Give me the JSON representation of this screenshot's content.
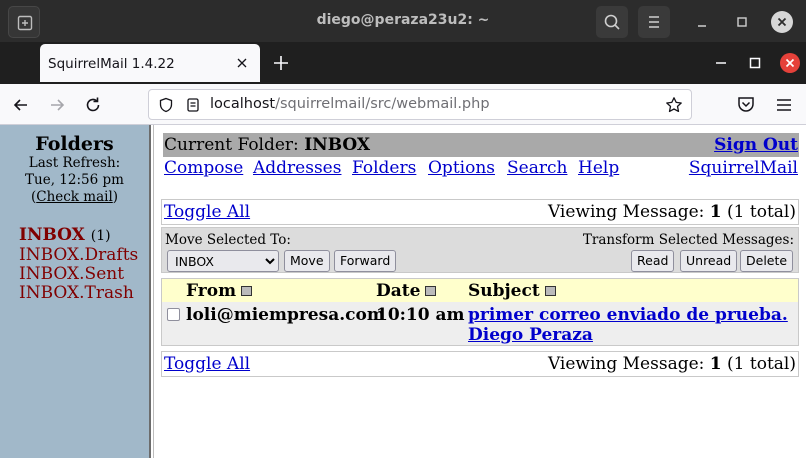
{
  "os": {
    "window_title": "diego@peraza23u2: ~"
  },
  "browser": {
    "tab_title": "SquirrelMail 1.4.22",
    "url_host": "localhost",
    "url_path": "/squirrelmail/src/webmail.php"
  },
  "left_pane": {
    "title": "Folders",
    "last_refresh_label": "Last Refresh:",
    "last_refresh_time": "Tue, 12:56 pm",
    "check_mail_open": "(",
    "check_mail_label": "Check mail",
    "check_mail_close": ")",
    "folders": [
      {
        "name": "INBOX",
        "unread": "(1)"
      },
      {
        "name": "INBOX.Drafts"
      },
      {
        "name": "INBOX.Sent"
      },
      {
        "name": "INBOX.Trash"
      }
    ]
  },
  "header": {
    "current_folder_label": "Current Folder:",
    "current_folder_name": "INBOX",
    "sign_out": "Sign Out",
    "menu": [
      "Compose",
      "Addresses",
      "Folders",
      "Options",
      "Search",
      "Help"
    ],
    "brand_link": "SquirrelMail"
  },
  "list_nav": {
    "toggle_all": "Toggle All",
    "viewing_prefix": "Viewing Message:",
    "viewing_number": "1",
    "viewing_suffix": "(1 total)"
  },
  "actions": {
    "move_selected_label": "Move Selected To:",
    "folder_select_value": "INBOX",
    "move_button": "Move",
    "forward_button": "Forward",
    "transform_label": "Transform Selected Messages:",
    "read_button": "Read",
    "unread_button": "Unread",
    "delete_button": "Delete"
  },
  "message_list": {
    "columns": [
      "From",
      "Date",
      "Subject"
    ],
    "rows": [
      {
        "from": "loli@miempresa.com",
        "date": "10:10 am",
        "subject": "primer correo enviado de prueba. Diego Peraza"
      }
    ]
  },
  "colors": {
    "left_pane_bg": "#a1b8c9",
    "folder_link": "#800000",
    "link": "#0000cc",
    "header_bar": "#a9a9a9",
    "column_header_bg": "#ffffcc",
    "row_bg": "#eeeeee"
  }
}
